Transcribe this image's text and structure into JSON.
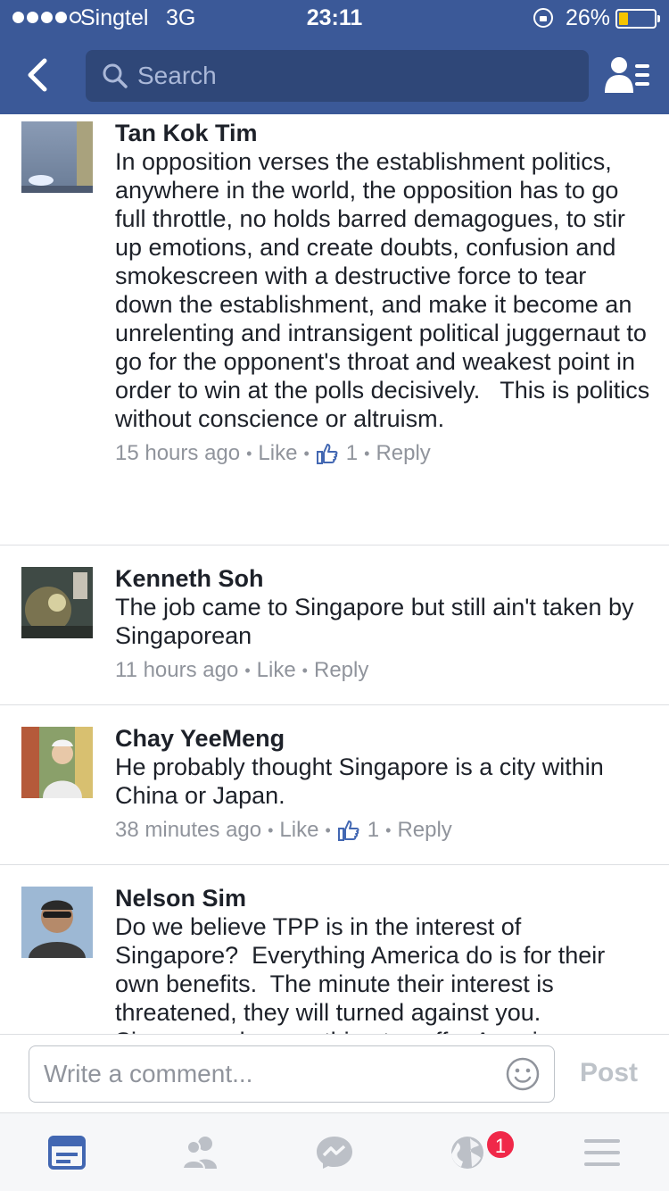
{
  "status": {
    "carrier": "Singtel",
    "network": "3G",
    "time": "23:11",
    "battery": "26%",
    "battery_level": 0.26,
    "signal_bars": 4,
    "signal_total": 5
  },
  "nav": {
    "search_placeholder": "Search"
  },
  "comments": [
    {
      "name": "Tan Kok Tim",
      "text": "In opposition verses the establishment politics, anywhere in the world, the opposition has to go full throttle, no holds barred demagogues, to stir up emotions, and create doubts, confusion and  smokescreen with a destructive force to tear down the establishment, and make it become an unrelenting and intransigent political juggernaut to go for the opponent's throat and weakest point in order to win at the polls decisively.   This is politics without conscience or altruism.",
      "time": "15 hours ago",
      "like": "Like",
      "likes": "1",
      "reply": "Reply"
    },
    {
      "name": "Kenneth Soh",
      "text": "The job came to Singapore but still ain't taken by Singaporean",
      "time": "11 hours ago",
      "like": "Like",
      "reply": "Reply"
    },
    {
      "name": "Chay YeeMeng",
      "text": "He probably thought Singapore is a city within China or Japan.",
      "time": "38 minutes ago",
      "like": "Like",
      "likes": "1",
      "reply": "Reply"
    },
    {
      "name": "Nelson Sim",
      "text": "Do we believe TPP is in the interest of Singapore?  Everything America do is for their own benefits.  The minute their interest is threatened, they will turned against you. Singapore do everything to suffer America"
    }
  ],
  "composer": {
    "placeholder": "Write a comment...",
    "post_label": "Post"
  },
  "tabbar": {
    "notifications_badge": "1"
  },
  "colors": {
    "brand": "#3b5998",
    "active_tab": "#4267b2",
    "badge": "#f02849",
    "battery": "#f5c400"
  }
}
